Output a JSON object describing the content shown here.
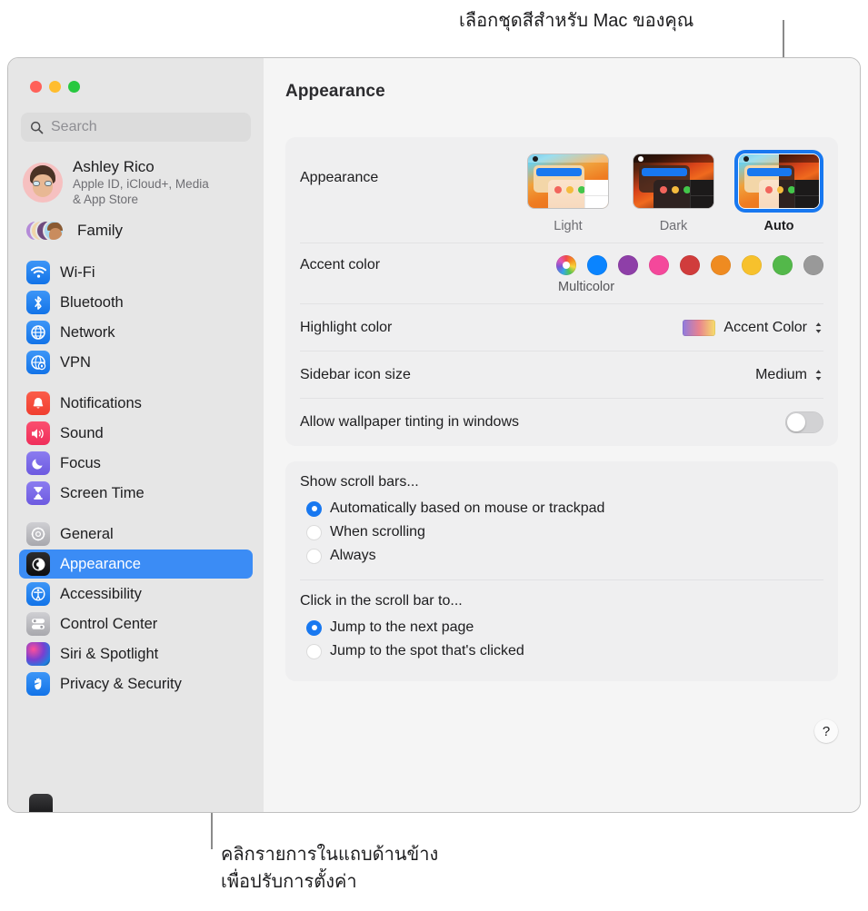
{
  "callouts": {
    "top": "เลือกชุดสีสำหรับ Mac ของคุณ",
    "bottom": "คลิกรายการในแถบด้านข้าง\nเพื่อปรับการตั้งค่า"
  },
  "window": {
    "traffic_lights": [
      "close",
      "minimize",
      "maximize"
    ]
  },
  "sidebar": {
    "search": {
      "placeholder": "Search",
      "value": ""
    },
    "account": {
      "name": "Ashley Rico",
      "subtitle": "Apple ID, iCloud+, Media\n& App Store"
    },
    "family": {
      "label": "Family"
    },
    "groups": [
      {
        "items": [
          {
            "label": "Wi-Fi",
            "icon": "wifi-icon"
          },
          {
            "label": "Bluetooth",
            "icon": "bluetooth-icon"
          },
          {
            "label": "Network",
            "icon": "network-globe-icon"
          },
          {
            "label": "VPN",
            "icon": "vpn-globe-icon"
          }
        ]
      },
      {
        "items": [
          {
            "label": "Notifications",
            "icon": "bell-icon"
          },
          {
            "label": "Sound",
            "icon": "speaker-icon"
          },
          {
            "label": "Focus",
            "icon": "moon-icon"
          },
          {
            "label": "Screen Time",
            "icon": "hourglass-icon"
          }
        ]
      },
      {
        "items": [
          {
            "label": "General",
            "icon": "gear-icon"
          },
          {
            "label": "Appearance",
            "icon": "appearance-contrast-icon",
            "selected": true
          },
          {
            "label": "Accessibility",
            "icon": "accessibility-icon"
          },
          {
            "label": "Control Center",
            "icon": "control-center-icon"
          },
          {
            "label": "Siri & Spotlight",
            "icon": "siri-orb-icon"
          },
          {
            "label": "Privacy & Security",
            "icon": "hand-privacy-icon"
          }
        ]
      }
    ]
  },
  "content": {
    "title": "Appearance",
    "appearance": {
      "label": "Appearance",
      "themes": [
        {
          "label": "Light",
          "selected": false
        },
        {
          "label": "Dark",
          "selected": false
        },
        {
          "label": "Auto",
          "selected": true
        }
      ]
    },
    "accent": {
      "label": "Accent color",
      "selected_name": "Multicolor",
      "swatches": [
        {
          "name": "Multicolor",
          "color": "multicolor",
          "selected": true
        },
        {
          "name": "Blue",
          "color": "#0a84ff"
        },
        {
          "name": "Purple",
          "color": "#8e3fa8"
        },
        {
          "name": "Pink",
          "color": "#f4489b"
        },
        {
          "name": "Red",
          "color": "#d03c3c"
        },
        {
          "name": "Orange",
          "color": "#ef8b21"
        },
        {
          "name": "Yellow",
          "color": "#f7c12c"
        },
        {
          "name": "Green",
          "color": "#53b84a"
        },
        {
          "name": "Graphite",
          "color": "#999999"
        }
      ]
    },
    "highlight": {
      "label": "Highlight color",
      "value": "Accent Color"
    },
    "sidebar_icon_size": {
      "label": "Sidebar icon size",
      "value": "Medium"
    },
    "wallpaper_tinting": {
      "label": "Allow wallpaper tinting in windows",
      "enabled": false
    },
    "scroll_bars": {
      "title": "Show scroll bars...",
      "options": [
        {
          "label": "Automatically based on mouse or trackpad",
          "selected": true
        },
        {
          "label": "When scrolling",
          "selected": false
        },
        {
          "label": "Always",
          "selected": false
        }
      ]
    },
    "scroll_click": {
      "title": "Click in the scroll bar to...",
      "options": [
        {
          "label": "Jump to the next page",
          "selected": true
        },
        {
          "label": "Jump to the spot that's clicked",
          "selected": false
        }
      ]
    },
    "help_button": "?"
  }
}
